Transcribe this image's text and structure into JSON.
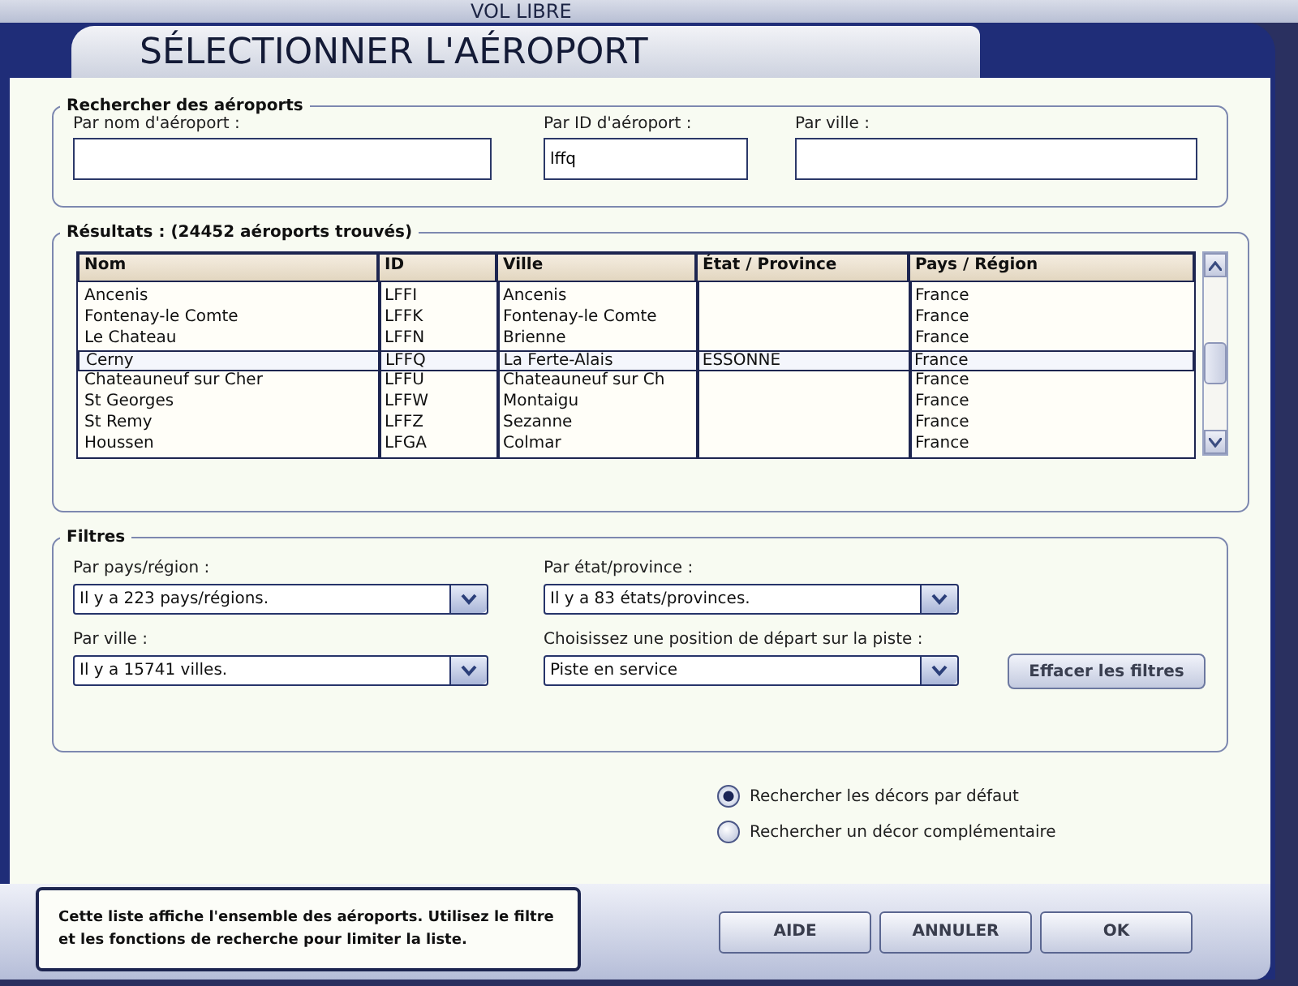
{
  "background_title": "VOL LIBRE",
  "window": {
    "title": "SÉLECTIONNER L'AÉROPORT"
  },
  "search": {
    "title": "Rechercher des aéroports",
    "fields": [
      {
        "label": "Par nom d'aéroport :"
      },
      {
        "label": "Par ID d'aéroport :",
        "value": "lffq"
      },
      {
        "label": "Par ville :"
      }
    ]
  },
  "results": {
    "title": "Résultats : (24452 aéroports trouvés)",
    "columns": [
      "Nom",
      "ID",
      "Ville",
      "État / Province",
      "Pays / Région"
    ],
    "rows": [
      {
        "cells": [
          "Ancenis",
          "LFFI",
          "Ancenis",
          "",
          "France"
        ],
        "selected": false
      },
      {
        "cells": [
          "Fontenay-le Comte",
          "LFFK",
          "Fontenay-le Comte",
          "",
          "France"
        ],
        "selected": false
      },
      {
        "cells": [
          "Le Chateau",
          "LFFN",
          "Brienne",
          "",
          "France"
        ],
        "selected": false
      },
      {
        "cells": [
          "Cerny",
          "LFFQ",
          "La Ferte-Alais",
          "ESSONNE",
          "France"
        ],
        "selected": true
      },
      {
        "cells": [
          "Chateauneuf sur Cher",
          "LFFU",
          "Chateauneuf sur Ch",
          "",
          "France"
        ],
        "selected": false
      },
      {
        "cells": [
          "St Georges",
          "LFFW",
          "Montaigu",
          "",
          "France"
        ],
        "selected": false
      },
      {
        "cells": [
          "St Remy",
          "LFFZ",
          "Sezanne",
          "",
          "France"
        ],
        "selected": false
      },
      {
        "cells": [
          "Houssen",
          "LFGA",
          "Colmar",
          "",
          "France"
        ],
        "selected": false
      }
    ]
  },
  "filters": {
    "title": "Filtres",
    "dropdowns": [
      {
        "label": "Par pays/région :",
        "value": "Il y a 223 pays/régions."
      },
      {
        "label": "Par état/province :",
        "value": "Il y a 83 états/provinces."
      },
      {
        "label": "Par ville :",
        "value": "Il y a 15741 villes."
      },
      {
        "label": "Choisissez une position de départ sur la piste :",
        "value": "Piste en service"
      }
    ],
    "clear_button": "Effacer les filtres"
  },
  "scenery_options": [
    {
      "label": "Rechercher les décors par défaut",
      "selected": true
    },
    {
      "label": "Rechercher un décor complémentaire",
      "selected": false
    }
  ],
  "help_text": "Cette liste affiche l'ensemble des aéroports. Utilisez le filtre et les fonctions de recherche pour limiter la liste.",
  "buttons": [
    "AIDE",
    "ANNULER",
    "OK"
  ]
}
